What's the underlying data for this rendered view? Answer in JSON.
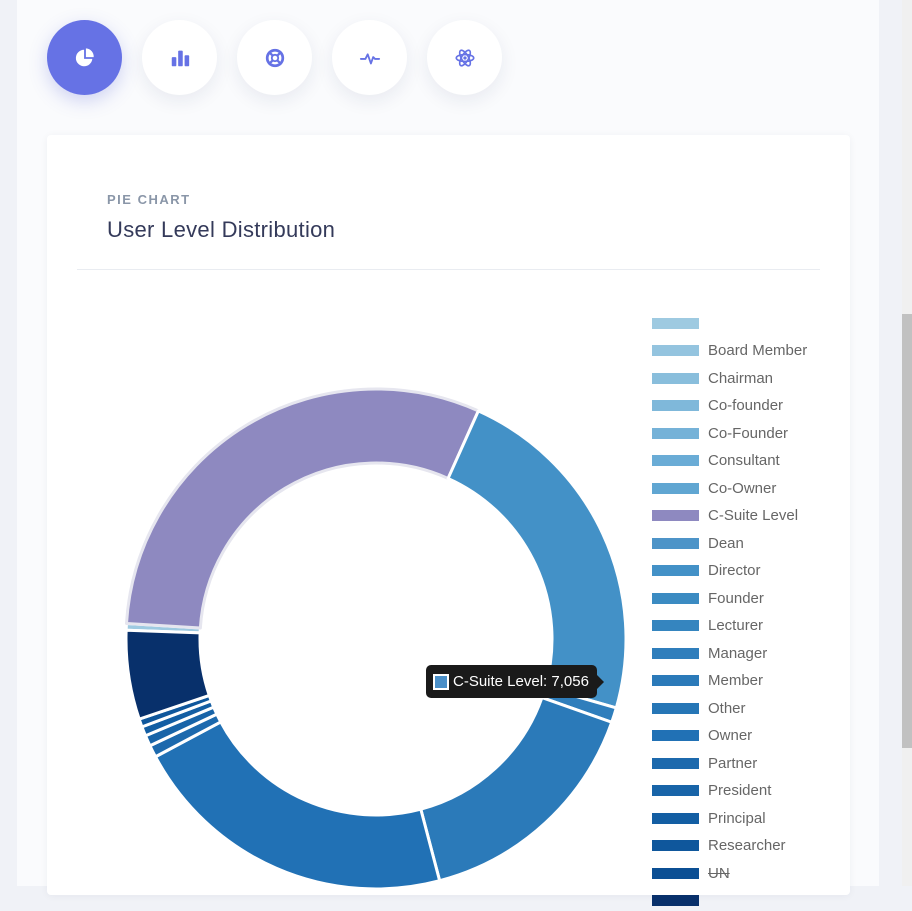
{
  "toolbar": {
    "buttons": [
      {
        "name": "pie-chart-icon-button",
        "icon": "pie-chart-icon",
        "active": true
      },
      {
        "name": "bar-chart-icon-button",
        "icon": "bar-chart-icon",
        "active": false
      },
      {
        "name": "life-ring-icon-button",
        "icon": "life-ring-icon",
        "active": false
      },
      {
        "name": "pulse-icon-button",
        "icon": "pulse-icon",
        "active": false
      },
      {
        "name": "atom-icon-button",
        "icon": "atom-icon",
        "active": false
      }
    ],
    "accent": "#6672e5"
  },
  "card": {
    "subtitle": "PIE CHART",
    "title": "User Level Distribution"
  },
  "tooltip": {
    "text": "C-Suite Level: 7,056",
    "swatch": "#4a8fc8"
  },
  "chart_data": {
    "type": "pie",
    "title": "User Level Distribution",
    "legend_position": "right",
    "slices": [
      {
        "label": "",
        "value": 100,
        "color": "#9ecae1"
      },
      {
        "label": "Board Member",
        "value": 0,
        "color": "#94c4df"
      },
      {
        "label": "Chairman",
        "value": 0,
        "color": "#89bedc"
      },
      {
        "label": "Co-founder",
        "value": 0,
        "color": "#7fb8da"
      },
      {
        "label": "Co-Founder",
        "value": 0,
        "color": "#75b2d8"
      },
      {
        "label": "Consultant",
        "value": 0,
        "color": "#6aacd6"
      },
      {
        "label": "Co-Owner",
        "value": 0,
        "color": "#60a6d2"
      },
      {
        "label": "C-Suite Level",
        "value": 7056,
        "color": "#8e89c0"
      },
      {
        "label": "Dean",
        "value": 0,
        "color": "#4d94c8"
      },
      {
        "label": "Director",
        "value": 5220,
        "color": "#4391c7"
      },
      {
        "label": "Founder",
        "value": 0,
        "color": "#3b8bc2"
      },
      {
        "label": "Lecturer",
        "value": 0,
        "color": "#3585bf"
      },
      {
        "label": "Manager",
        "value": 220,
        "color": "#2f7ebc"
      },
      {
        "label": "Member",
        "value": 3560,
        "color": "#2b7ab9"
      },
      {
        "label": "Other",
        "value": 0,
        "color": "#2676b6"
      },
      {
        "label": "Owner",
        "value": 4890,
        "color": "#2171b5"
      },
      {
        "label": "Partner",
        "value": 180,
        "color": "#1c69ad"
      },
      {
        "label": "President",
        "value": 160,
        "color": "#1864a8"
      },
      {
        "label": "Principal",
        "value": 140,
        "color": "#135ea3"
      },
      {
        "label": "Researcher",
        "value": 120,
        "color": "#0f579c"
      },
      {
        "label": "UN",
        "value": 0,
        "color": "#0b4f94",
        "hidden": true
      },
      {
        "label": "",
        "value": 1320,
        "color": "#08306b"
      }
    ]
  }
}
